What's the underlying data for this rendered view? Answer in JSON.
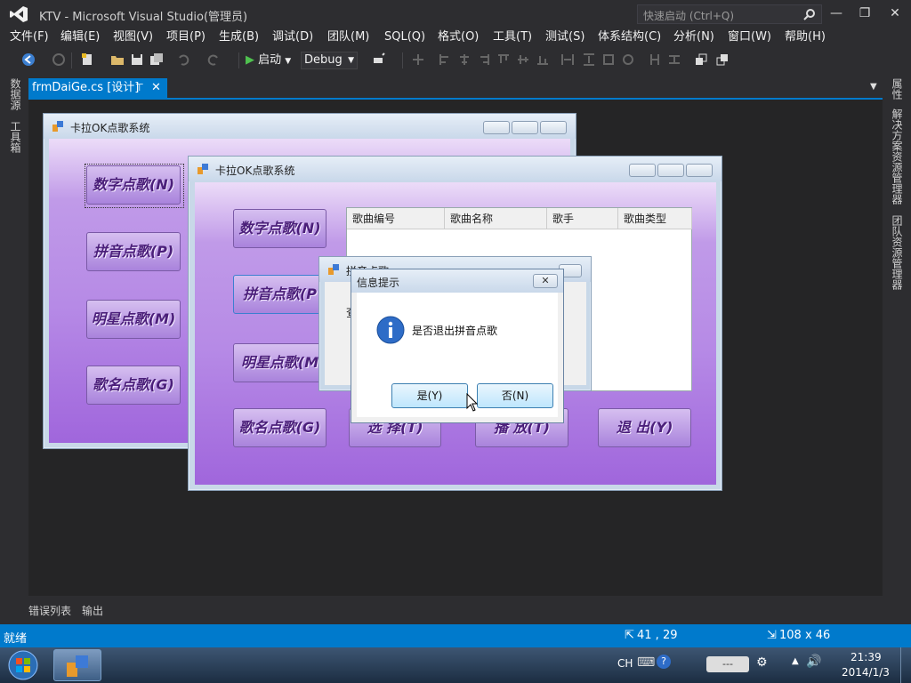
{
  "app": {
    "title": "KTV - Microsoft Visual Studio(管理员)",
    "quick_launch_placeholder": "快速启动 (Ctrl+Q)"
  },
  "menu": [
    "文件(F)",
    "编辑(E)",
    "视图(V)",
    "项目(P)",
    "生成(B)",
    "调试(D)",
    "团队(M)",
    "SQL(Q)",
    "格式(O)",
    "工具(T)",
    "测试(S)",
    "体系结构(C)",
    "分析(N)",
    "窗口(W)",
    "帮助(H)"
  ],
  "toolbar": {
    "start_label": "启动",
    "config": "Debug"
  },
  "left_strip": [
    "数据源",
    "工具箱"
  ],
  "right_strip": [
    "属性",
    "解决方案资源管理器",
    "团队资源管理器"
  ],
  "tab": {
    "label": "frmDaiGe.cs [设计]"
  },
  "form1": {
    "title": "卡拉OK点歌系统",
    "buttons": [
      "数字点歌(N)",
      "拼音点歌(P)",
      "明星点歌(M)",
      "歌名点歌(G)"
    ]
  },
  "form2": {
    "title": "卡拉OK点歌系统",
    "buttons": [
      "数字点歌(N)",
      "拼音点歌(P",
      "明星点歌(M",
      "歌名点歌(G)"
    ],
    "bottom_buttons": [
      "选 择(T)",
      "播 放(T)",
      "退 出(Y)"
    ],
    "columns": [
      "歌曲编号",
      "歌曲名称",
      "歌手",
      "歌曲类型"
    ]
  },
  "form3": {
    "title": "拼音点歌",
    "label": "查"
  },
  "dialog": {
    "title": "信息提示",
    "message": "是否退出拼音点歌",
    "yes": "是(Y)",
    "no": "否(N)"
  },
  "bottom_tabs": [
    "错误列表",
    "输出"
  ],
  "status": {
    "text": "就绪",
    "position": "41 , 29",
    "size": "108 x 46"
  },
  "tray": {
    "ime": "CH",
    "time": "21:39",
    "date": "2014/1/3",
    "battery": "---"
  },
  "colors": {
    "accent": "#007acc",
    "ide_bg": "#2d2d30",
    "form_purple": "#b68ae6"
  }
}
